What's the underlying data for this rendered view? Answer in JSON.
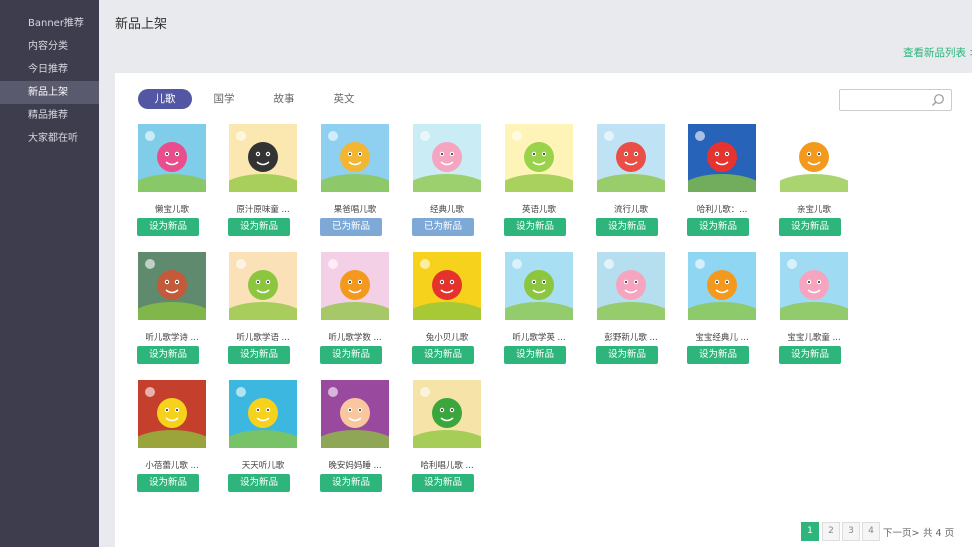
{
  "sidebar": {
    "items": [
      {
        "label": "Banner推荐",
        "active": false
      },
      {
        "label": "内容分类",
        "active": false
      },
      {
        "label": "今日推荐",
        "active": false
      },
      {
        "label": "新品上架",
        "active": true
      },
      {
        "label": "精品推荐",
        "active": false
      },
      {
        "label": "大家都在听",
        "active": false
      }
    ]
  },
  "header": {
    "title": "新品上架",
    "view_link": "查看新品列表 >"
  },
  "tabs": [
    {
      "label": "儿歌",
      "active": true
    },
    {
      "label": "国学",
      "active": false
    },
    {
      "label": "故事",
      "active": false
    },
    {
      "label": "英文",
      "active": false
    }
  ],
  "search": {
    "placeholder": ""
  },
  "cards": [
    {
      "title": "懒宝儿歌",
      "button": "设为新品",
      "done": false,
      "bg": "#7fcde8",
      "accent": "#e94d8b"
    },
    {
      "title": "原汁原味童 ...",
      "button": "设为新品",
      "done": false,
      "bg": "#fbe8b0",
      "accent": "#333333"
    },
    {
      "title": "果爸唱儿歌",
      "button": "已为新品",
      "done": true,
      "bg": "#8fd0f0",
      "accent": "#f2b632"
    },
    {
      "title": "经典儿歌",
      "button": "已为新品",
      "done": true,
      "bg": "#c9ecf5",
      "accent": "#f6a5c0"
    },
    {
      "title": "英语儿歌",
      "button": "设为新品",
      "done": false,
      "bg": "#fff4b8",
      "accent": "#9ad24b"
    },
    {
      "title": "流行儿歌",
      "button": "设为新品",
      "done": false,
      "bg": "#bfe3f4",
      "accent": "#e94f46"
    },
    {
      "title": "哈利儿歌：...",
      "button": "设为新品",
      "done": false,
      "bg": "#2763b8",
      "accent": "#e8322f"
    },
    {
      "title": "亲宝儿歌",
      "button": "设为新品",
      "done": false,
      "bg": "#ffffff",
      "accent": "#f39a1e"
    },
    {
      "title": "听儿歌学诗 ...",
      "button": "设为新品",
      "done": false,
      "bg": "#5f8a6e",
      "accent": "#c45a3a"
    },
    {
      "title": "听儿歌学语 ...",
      "button": "设为新品",
      "done": false,
      "bg": "#fbe1b8",
      "accent": "#8cc63f"
    },
    {
      "title": "听儿歌学数 ...",
      "button": "设为新品",
      "done": false,
      "bg": "#f4d0e6",
      "accent": "#f39a1e"
    },
    {
      "title": "兔小贝儿歌",
      "button": "设为新品",
      "done": false,
      "bg": "#f7d21c",
      "accent": "#e5322d"
    },
    {
      "title": "听儿歌学英 ...",
      "button": "设为新品",
      "done": false,
      "bg": "#a9dff2",
      "accent": "#8cc63f"
    },
    {
      "title": "彭野新儿歌 ...",
      "button": "设为新品",
      "done": false,
      "bg": "#b5dfef",
      "accent": "#f6a5c0"
    },
    {
      "title": "宝宝经典儿 ...",
      "button": "设为新品",
      "done": false,
      "bg": "#8fd6f2",
      "accent": "#f39a1e"
    },
    {
      "title": "宝宝儿歌童 ...",
      "button": "设为新品",
      "done": false,
      "bg": "#9fdcf3",
      "accent": "#f6a5c0"
    },
    {
      "title": "小蓓蕾儿歌 ...",
      "button": "设为新品",
      "done": false,
      "bg": "#c4402d",
      "accent": "#f7d21c"
    },
    {
      "title": "天天听儿歌",
      "button": "设为新品",
      "done": false,
      "bg": "#3cb8e0",
      "accent": "#f7d21c"
    },
    {
      "title": "晚安妈妈睡 ...",
      "button": "设为新品",
      "done": false,
      "bg": "#9a4a9e",
      "accent": "#f8c7a0"
    },
    {
      "title": "哈利唱儿歌 ...",
      "button": "设为新品",
      "done": false,
      "bg": "#f5e3a8",
      "accent": "#3aa63c"
    }
  ],
  "pagination": {
    "pages": [
      "1",
      "2",
      "3",
      "4"
    ],
    "current": "1",
    "next_label": "下一页>",
    "total_label": "共 4 页"
  },
  "colors": {
    "accent_green": "#2db57c",
    "tab_active": "#5356a3",
    "sidebar_bg": "#3d3d4e",
    "done_button": "#7ea9d6"
  }
}
